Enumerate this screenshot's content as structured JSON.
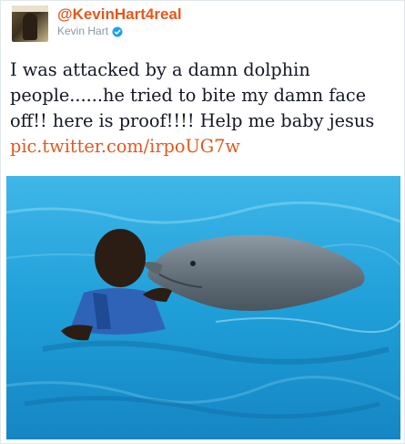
{
  "tweet": {
    "handle": "@KevinHart4real",
    "display_name": "Kevin Hart",
    "text_lines": [
      "I was attacked by a damn dolphin",
      "people......he tried to bite my damn face",
      "off!! here is proof!!!! Help me baby jesus"
    ],
    "link": "pic.twitter.com/irpoUG7w",
    "verified": true
  },
  "colors": {
    "accent": "#e4581c",
    "secondary_text": "#8899a6",
    "verified": "#1da1f2",
    "body_text": "#141823"
  },
  "icons": {
    "verified": "verified-badge-icon"
  }
}
